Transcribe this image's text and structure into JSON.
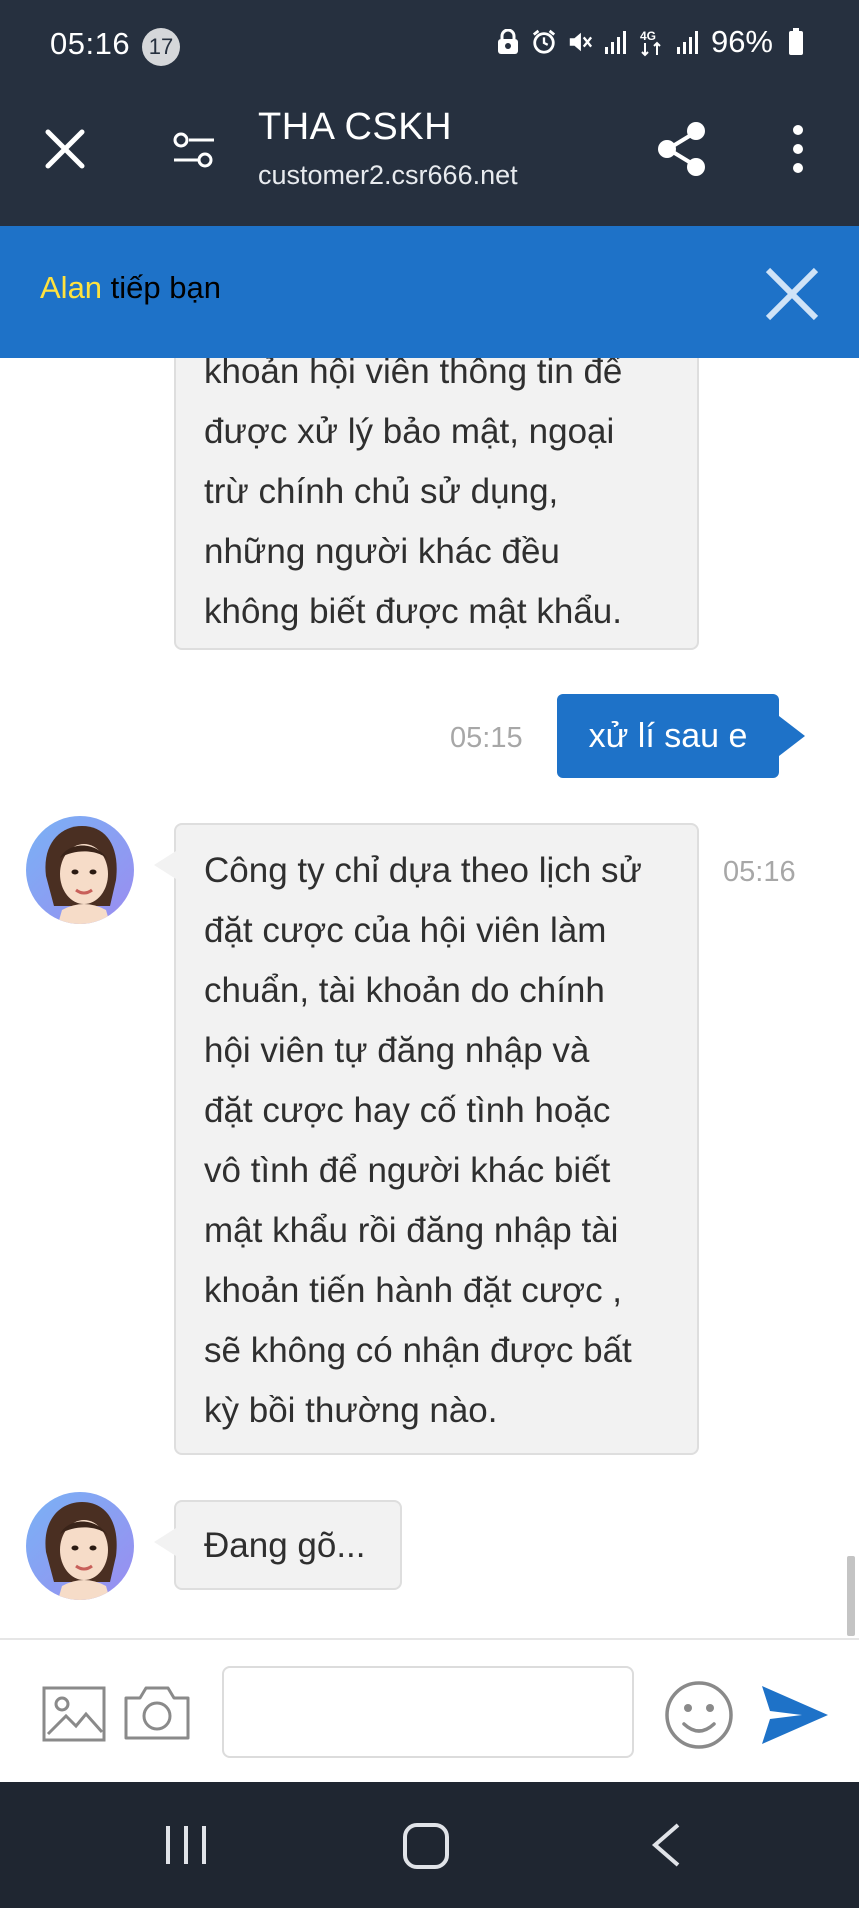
{
  "status_bar": {
    "time": "05:16",
    "notification_count": "17",
    "battery": "96%",
    "icons": [
      "recycle-lock-icon",
      "alarm-icon",
      "mute-icon",
      "signal-icon",
      "data-4g-icon",
      "signal-icon",
      "battery-icon"
    ]
  },
  "browser": {
    "title": "THA CSKH",
    "url": "customer2.csr666.net"
  },
  "banner": {
    "agent_name": "Alan",
    "text": " tiếp bạn"
  },
  "messages": [
    {
      "from": "agent",
      "lines": [
        "khoản hội viên thông tin để",
        "được xử lý bảo mật, ngoại",
        "trừ chính chủ sử dụng,",
        "những người khác đều",
        "không biết được mật khẩu."
      ]
    },
    {
      "from": "user",
      "text": "xử lí sau e",
      "time": "05:15"
    },
    {
      "from": "agent",
      "time": "05:16",
      "lines": [
        "Công ty chỉ dựa theo lịch sử",
        "đặt cược của hội viên làm",
        "chuẩn, tài khoản do chính",
        "hội viên tự đăng nhập và",
        "đặt cược hay cố tình hoặc",
        "vô tình để người khác biết",
        "mật khẩu rồi đăng nhập tài",
        "khoản tiến hành đặt cược ,",
        "sẽ không có nhận được bất",
        "kỳ bồi thường nào."
      ]
    },
    {
      "from": "agent",
      "typing_text": "Đang gõ..."
    }
  ],
  "input": {
    "value": "",
    "placeholder": ""
  },
  "colors": {
    "header_bg": "#26303f",
    "banner_bg": "#1e72c8",
    "agent_name": "#ffe23e",
    "user_bubble": "#1e72c8",
    "agent_bubble": "#f2f2f2",
    "send_icon": "#1e72c8"
  }
}
